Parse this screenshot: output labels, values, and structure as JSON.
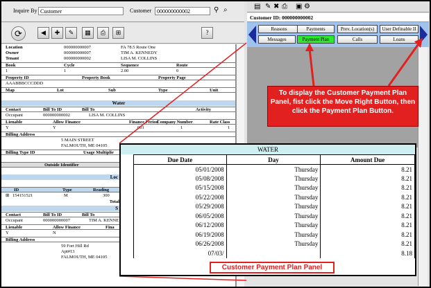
{
  "search": {
    "inquire_label": "Inquire By",
    "inquire_value": "Customer",
    "customer_label": "Customer",
    "customer_value": "000000000002"
  },
  "left": {
    "location_label": "Location",
    "location_id": "000000000007",
    "location_addr": "FA 78.5 Route One",
    "owner_label": "Owner",
    "owner_id": "000000000007",
    "owner_name": "TIM A. KENNEDY",
    "tenant_label": "Tenant",
    "tenant_id": "000000000002",
    "tenant_name": "LISA M. COLLINS",
    "book_hdr": "Book",
    "cycle_hdr": "Cycle",
    "sequence_hdr": "Sequence",
    "route_hdr": "Route",
    "book_val": "1",
    "cycle_val": "1",
    "sequence_val": "2.00",
    "route_val": "0",
    "propid_hdr": "Property ID",
    "propbook_hdr": "Property Book",
    "proppage_hdr": "Property Page",
    "propid_val": "AAABBBCCCDDD",
    "map_hdr": "Map",
    "lot_hdr": "Lot",
    "sub_hdr": "Sub",
    "type_hdr": "Type",
    "unit_hdr": "Unit",
    "water_section": "Water",
    "contact_hdr": "Contact",
    "billtoid_hdr": "Bill To ID",
    "billto_hdr": "Bill To",
    "activity_hdr": "Activity",
    "occupant": "Occupant",
    "occ_id": "000000000002",
    "occ_name": "LISA M. COLLINS",
    "lienable_hdr": "Lienable",
    "allowfin_hdr": "Allow Finance",
    "finper_hdr": "Finance Period",
    "compnum_hdr": "Company Number",
    "rate_hdr": "Rate Class",
    "lien_y": "Y",
    "allow_y": "Y",
    "finper_val": "001",
    "comp_val": "1",
    "rate_val": "1",
    "billing_addr_hdr": "Billing Address",
    "addr1": "5 MAIN STREET",
    "addr2": "FALMOUTH, ME 04105",
    "billing_type_hdr": "Billing Type ID",
    "usage_mult_hdr": "Usage Multiplie",
    "outside_id_hdr": "Outside Identifier",
    "loc_section": "Loc",
    "id_hdr": "ID",
    "type_col_hdr": "Type",
    "reading_hdr": "Reading",
    "meter_id": "154151521",
    "meter_type": "M",
    "meter_reading": "300",
    "total_lbl": "Total",
    "s_section": "S",
    "contact2_hdr": "Contact",
    "billtoid2_hdr": "Bill To ID",
    "billto2_hdr": "Bill To",
    "occupant2": "Occupant",
    "occ2_id": "000000000007",
    "occ2_name": "TIM A. KENNE",
    "lienable2_hdr": "Lienable",
    "allowfin2_hdr": "Allow Finance",
    "fina2_hdr": "Fina",
    "lien2_val": "Y",
    "allow2_val": "N",
    "billing_addr2_hdr": "Billing Address",
    "addr2_1": "59 Fort Hill Rd",
    "addr2_2": "Apt#13",
    "addr2_3": "FALMOUTH, ME 04105"
  },
  "right": {
    "custid_label": "Customer ID:",
    "custid_value": "000000000002",
    "nav": {
      "reasons": "Reasons",
      "payments": "Payments",
      "prev_locations": "Prev. Location(s)",
      "user_definable": "User Definable II",
      "messages": "Messages",
      "payment_plan": "Payment Plan",
      "calls": "Calls",
      "loans": "Loans"
    }
  },
  "callout_text": "To display the Customer Payment Plan Panel, fist click the Move Right Button, then click the Payment Plan Button.",
  "plan": {
    "title": "WATER",
    "headers": [
      "Due Date",
      "Day",
      "Amount Due"
    ],
    "rows": [
      [
        "05/01/2008",
        "Thursday",
        "8.21"
      ],
      [
        "05/08/2008",
        "Thursday",
        "8.21"
      ],
      [
        "05/15/2008",
        "Thursday",
        "8.21"
      ],
      [
        "05/22/2008",
        "Thursday",
        "8.21"
      ],
      [
        "05/29/2008",
        "Thursday",
        "8.21"
      ],
      [
        "06/05/2008",
        "Thursday",
        "8.21"
      ],
      [
        "06/12/2008",
        "Thursday",
        "8.21"
      ],
      [
        "06/19/2008",
        "Thursday",
        "8.21"
      ],
      [
        "06/26/2008",
        "Thursday",
        "8.21"
      ],
      [
        "07/03/",
        "",
        "8.18"
      ]
    ],
    "caption": "Customer Payment Plan Panel"
  },
  "colors": {
    "callout": "#e32020",
    "nav_panel": "#9fc3ec",
    "active_button": "#2ee82e",
    "section": "#bcd7ee",
    "plan_title": "#cdeff2"
  }
}
